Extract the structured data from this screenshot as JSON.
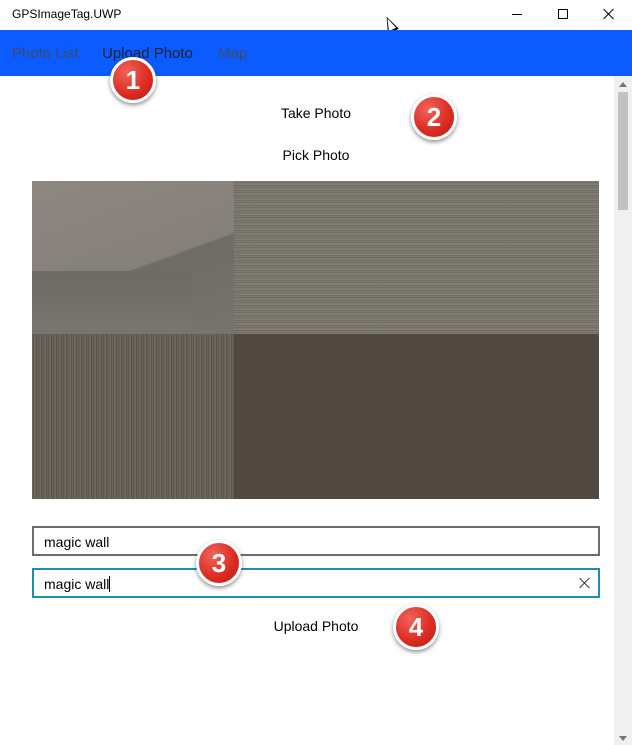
{
  "window": {
    "title": "GPSImageTag.UWP",
    "icons": {
      "minimize": "minimize-icon",
      "maximize": "maximize-icon",
      "close": "close-icon"
    }
  },
  "nav": {
    "accent": "#0a5cff",
    "tabs": [
      {
        "label": "Photo List"
      },
      {
        "label": "Upload Photo",
        "active": true
      },
      {
        "label": "Map"
      }
    ]
  },
  "main": {
    "take_photo_label": "Take Photo",
    "pick_photo_label": "Pick Photo",
    "field_1_value": "magic wall",
    "field_2_value": "magic wall",
    "upload_label": "Upload Photo"
  },
  "annotations": {
    "color": "#dd2d24",
    "badges": [
      "1",
      "2",
      "3",
      "4"
    ]
  }
}
